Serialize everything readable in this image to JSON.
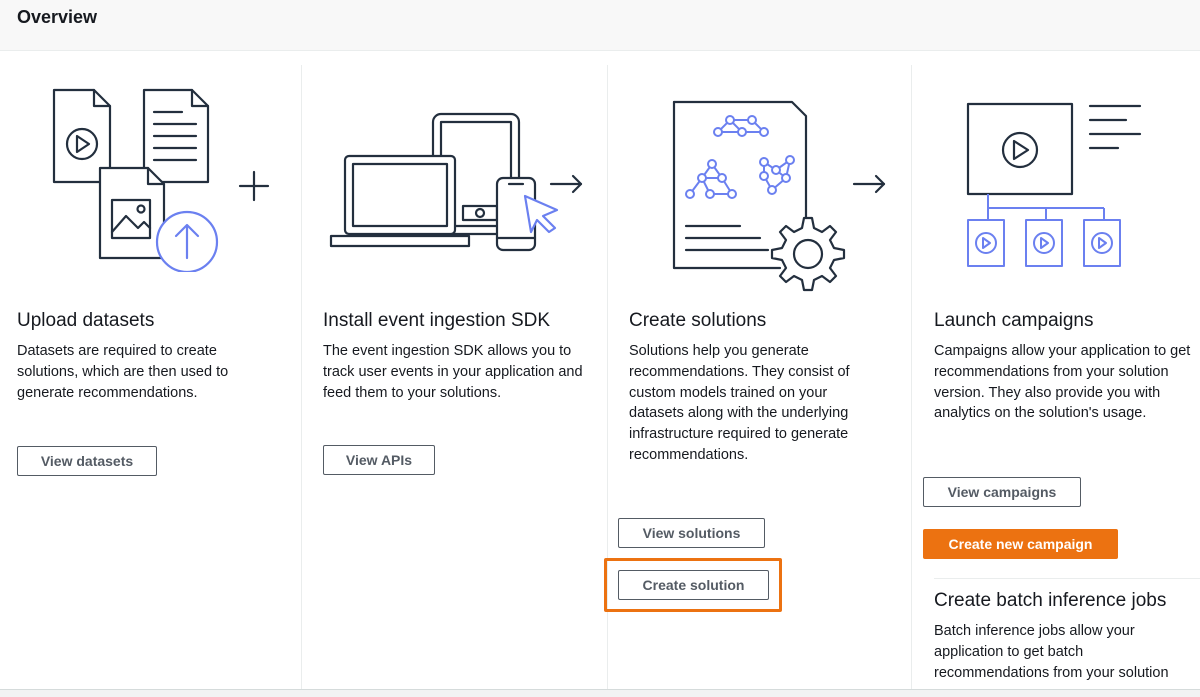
{
  "header": {
    "title": "Overview"
  },
  "columns": [
    {
      "title": "Upload datasets",
      "description": "Datasets are required to create solutions, which are then used to generate recommendations.",
      "buttons": [
        "View datasets"
      ]
    },
    {
      "title": "Install event ingestion SDK",
      "description": "The event ingestion SDK allows you to track user events in your application and feed them to your solutions.",
      "buttons": [
        "View APIs"
      ]
    },
    {
      "title": "Create solutions",
      "description": "Solutions help you generate recommendations. They consist of custom models trained on your datasets along with the underlying infrastructure required to generate recommendations.",
      "buttons": [
        "View solutions",
        "Create solution"
      ]
    },
    {
      "title": "Launch campaigns",
      "description": "Campaigns allow your application to get recommendations from your solution version. They also provide you with analytics on the solution's usage.",
      "buttons": [
        "View campaigns",
        "Create new campaign"
      ]
    }
  ],
  "batch": {
    "title": "Create batch inference jobs",
    "description": "Batch inference jobs allow your application to get batch recommendations from your solution"
  },
  "colors": {
    "accent": "#ec7211",
    "icon_blue": "#6b80f0",
    "icon_gray": "#232f3e"
  }
}
